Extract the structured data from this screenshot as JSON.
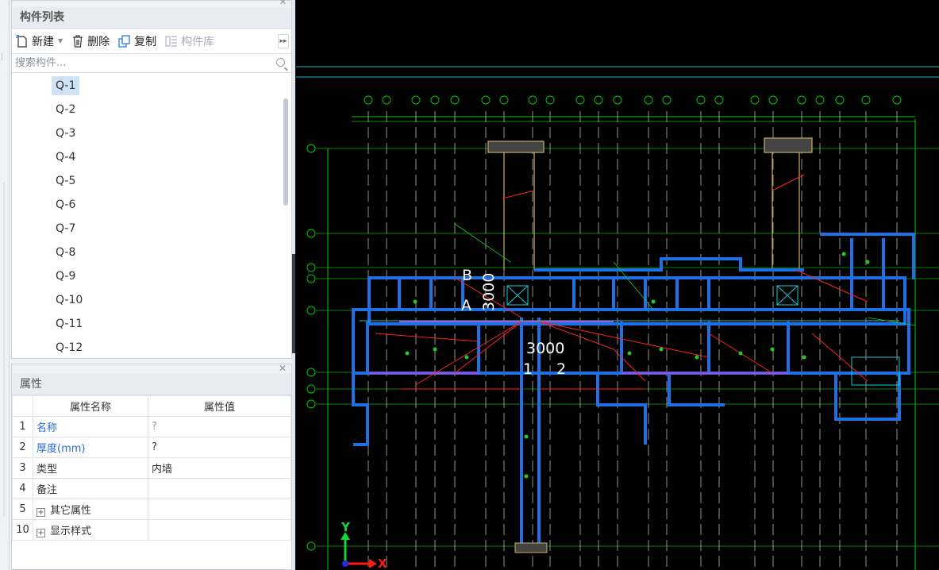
{
  "component_panel": {
    "title": "构件列表",
    "toolbar": {
      "new_label": "新建",
      "delete_label": "删除",
      "copy_label": "复制",
      "library_label": "构件库"
    },
    "search_placeholder": "搜索构件...",
    "items": [
      "Q-1",
      "Q-2",
      "Q-3",
      "Q-4",
      "Q-5",
      "Q-6",
      "Q-7",
      "Q-8",
      "Q-9",
      "Q-10",
      "Q-11",
      "Q-12"
    ],
    "selected_index": 0
  },
  "properties_panel": {
    "title": "属性",
    "col_name": "属性名称",
    "col_value": "属性值",
    "rows": [
      {
        "idx": "1",
        "name": "名称",
        "value": "?"
      },
      {
        "idx": "2",
        "name": "厚度(mm)",
        "value": "?"
      },
      {
        "idx": "3",
        "name": "类型",
        "value": "内墙"
      },
      {
        "idx": "4",
        "name": "备注",
        "value": ""
      },
      {
        "idx": "5",
        "name": "其它属性",
        "value": ""
      },
      {
        "idx": "10",
        "name": "显示样式",
        "value": ""
      }
    ]
  },
  "drawing": {
    "dim_label_1": "3000",
    "dim_label_2": "3000",
    "label_b": "B",
    "label_a": "A",
    "label_1": "1",
    "label_2": "2",
    "axis_y": "Y",
    "axis_x": "X"
  },
  "colors": {
    "wall": "#1f6fe6",
    "axis_line": "#00c800",
    "red_line": "#ff2020",
    "bg": "#000000"
  }
}
